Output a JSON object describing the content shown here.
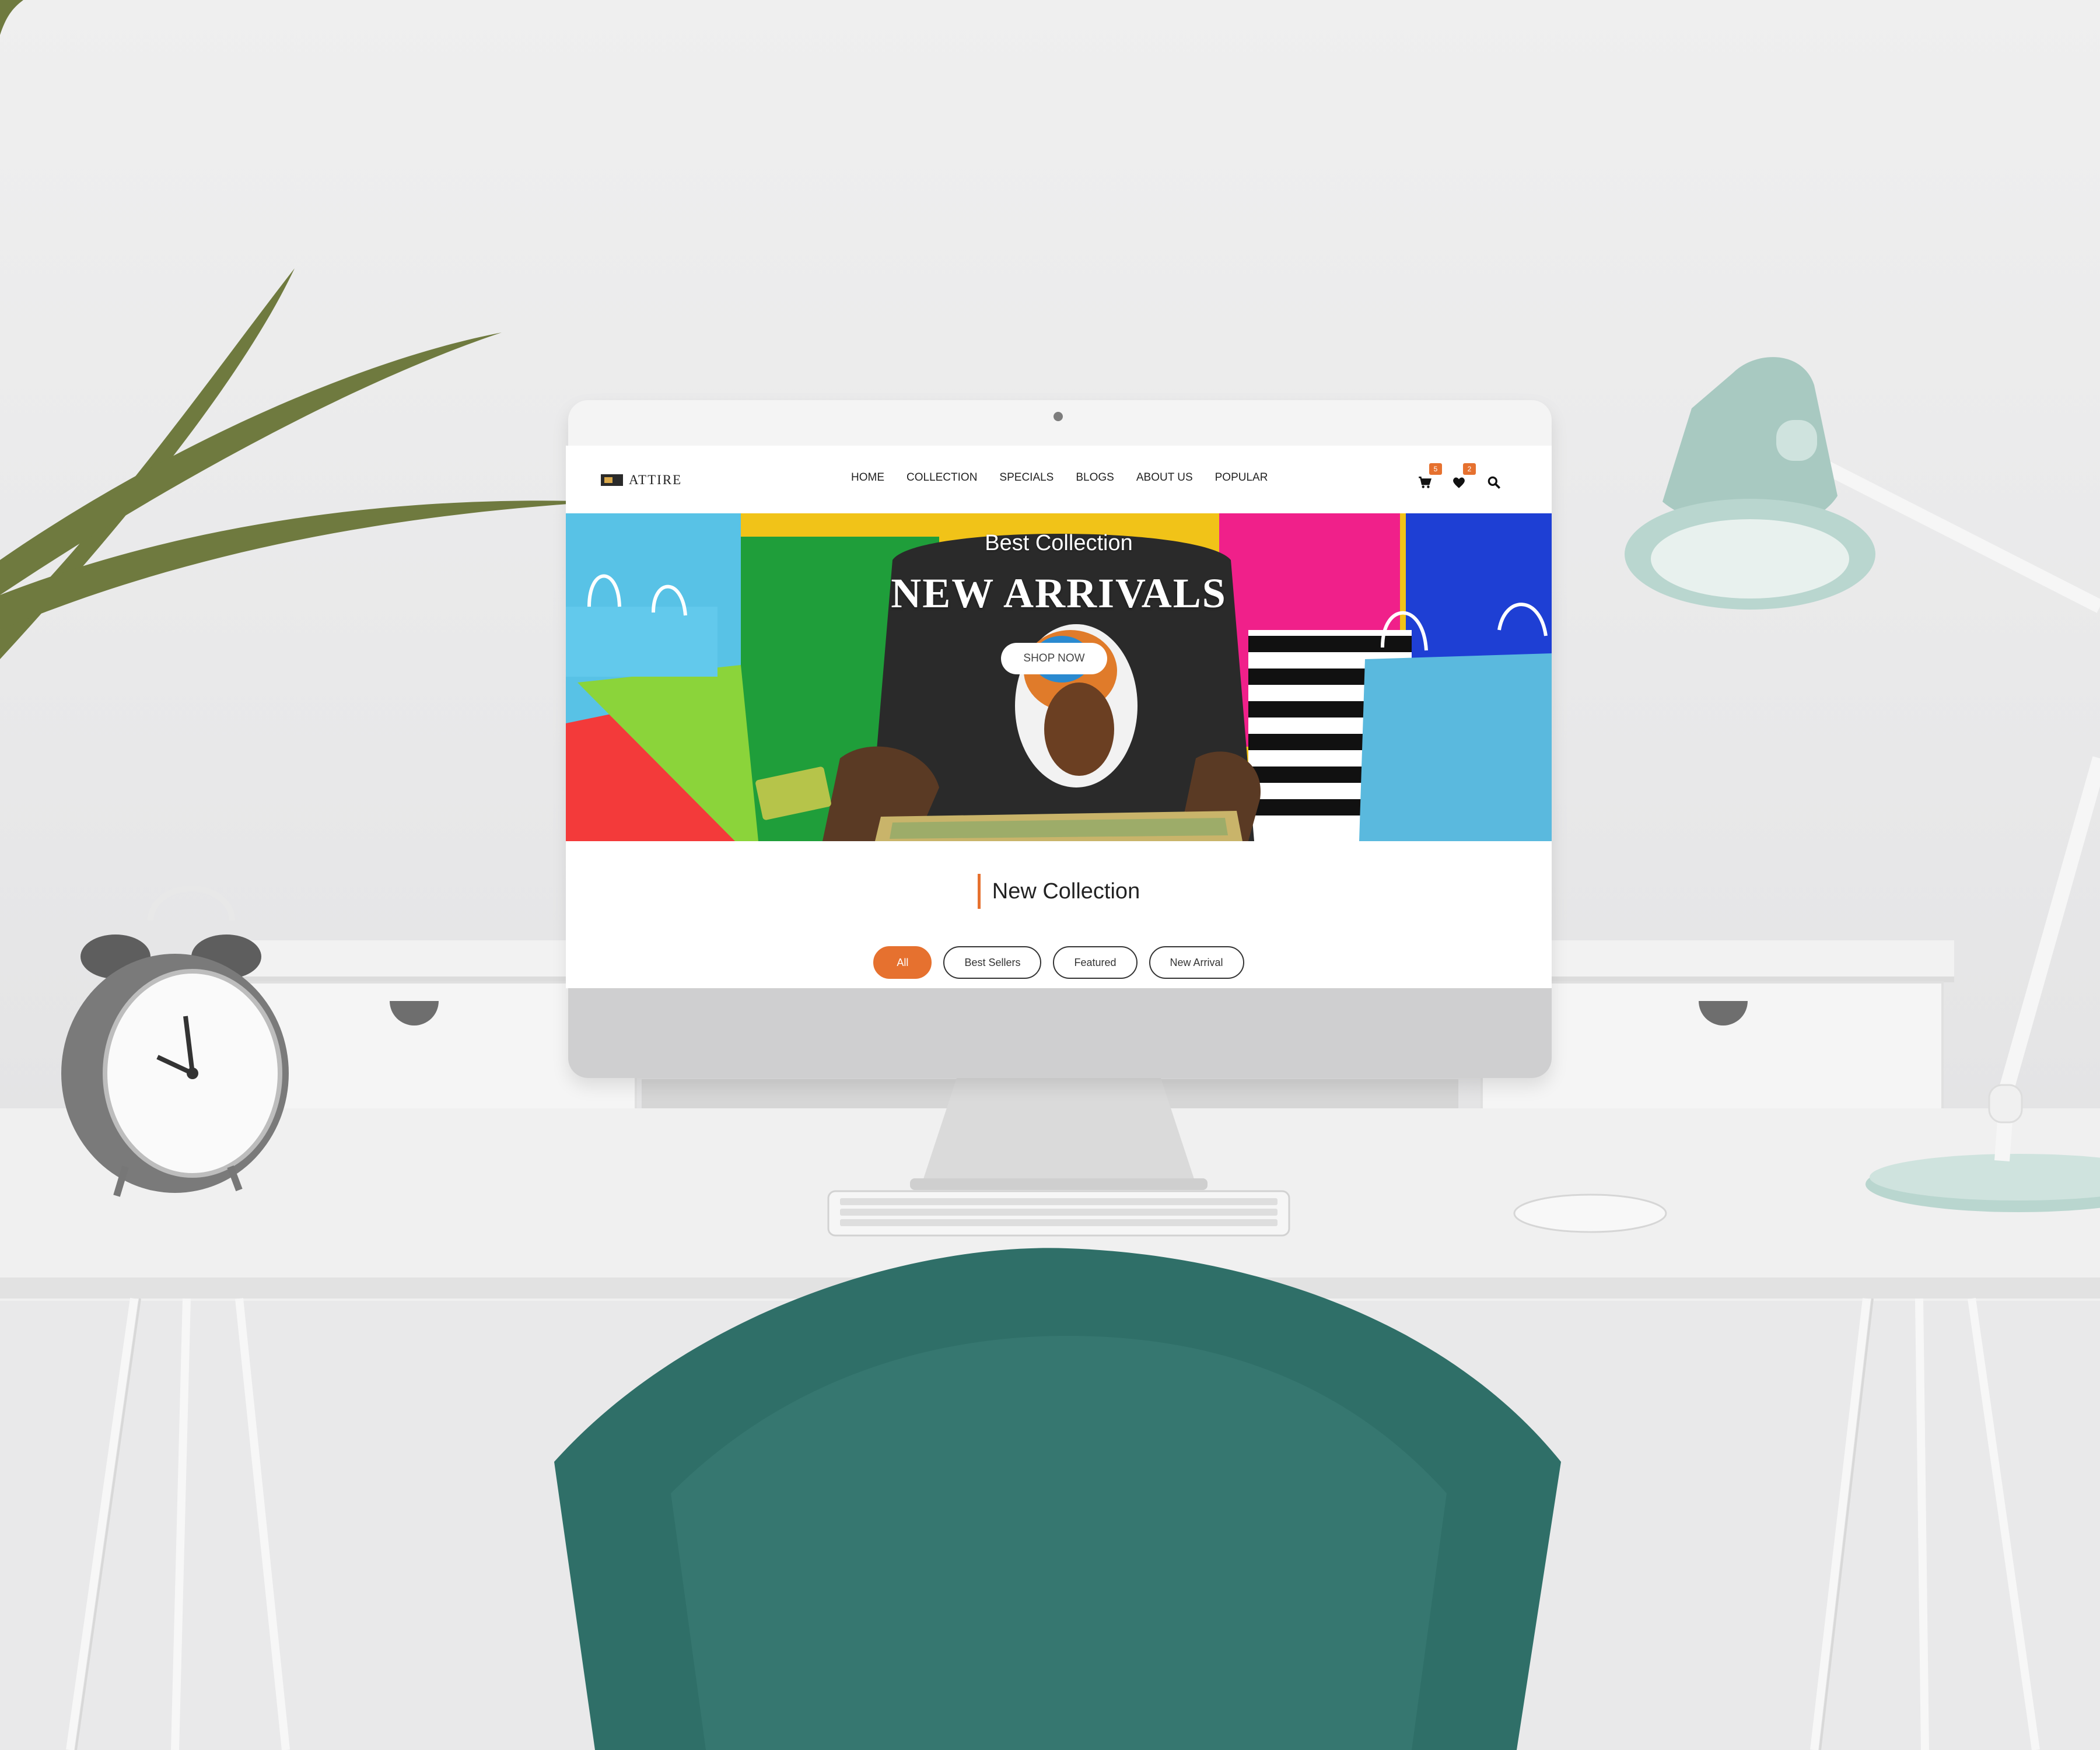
{
  "brand": {
    "name": "ATTIRE"
  },
  "nav": {
    "items": [
      "HOME",
      "COLLECTION",
      "SPECIALS",
      "BLOGS",
      "ABOUT US",
      "POPULAR"
    ],
    "cart_count": "5",
    "wishlist_count": "2",
    "icons": [
      "cart-icon",
      "heart-icon",
      "search-icon"
    ]
  },
  "hero": {
    "subtitle": "Best Collection",
    "title": "NEW ARRIVALS",
    "cta": "SHOP NOW"
  },
  "collection": {
    "title": "New Collection",
    "filters": [
      "All",
      "Best Sellers",
      "Featured",
      "New Arrival"
    ],
    "active_filter": "All"
  },
  "colors": {
    "accent": "#e6712f",
    "chair": "#2f6f68",
    "lamp": "#b9d6cf"
  }
}
